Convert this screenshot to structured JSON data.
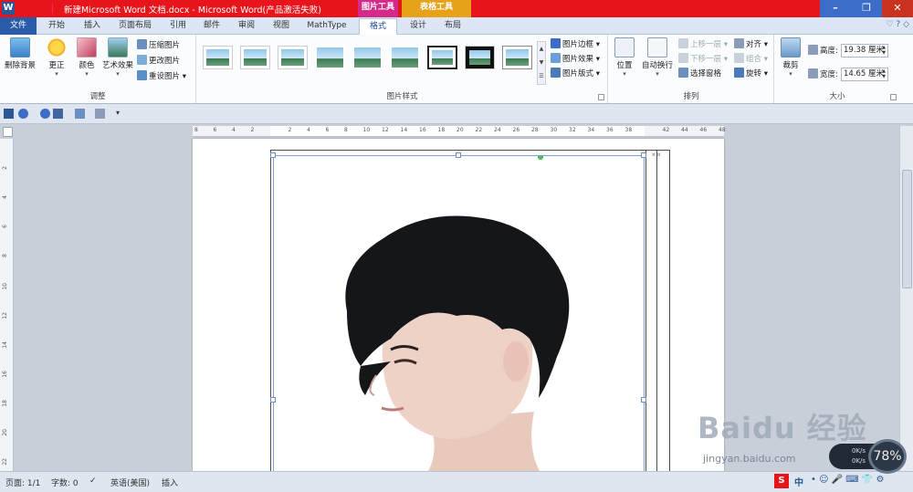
{
  "titlebar": {
    "logo": "W",
    "title": "新建Microsoft Word 文档.docx - Microsoft Word(产品激活失败)",
    "context_picture": "图片工具",
    "context_table": "表格工具",
    "min": "–",
    "max": "❐",
    "close": "✕"
  },
  "tabs": {
    "file": "文件",
    "items": [
      "开始",
      "插入",
      "页面布局",
      "引用",
      "邮件",
      "审阅",
      "视图",
      "MathType",
      "格式",
      "设计",
      "布局"
    ],
    "right_icons": "♡ ? ◇"
  },
  "ribbon": {
    "adjust": {
      "label": "调整",
      "remove_bg": "删除背景",
      "correct": "更正",
      "color": "颜色",
      "art_effects": "艺术效果",
      "compress": "压缩图片",
      "change": "更改图片",
      "reset": "重设图片"
    },
    "styles": {
      "label": "图片样式",
      "border": "图片边框",
      "effects": "图片效果",
      "layout": "图片版式"
    },
    "arrange": {
      "label": "排列",
      "position": "位置",
      "wrap": "自动换行",
      "forward": "上移一层",
      "backward": "下移一层",
      "selection_pane": "选择窗格",
      "align": "对齐",
      "group": "组合",
      "rotate": "旋转"
    },
    "size": {
      "label": "大小",
      "crop": "裁剪",
      "height_label": "高度:",
      "height_value": "19.38 厘米",
      "width_label": "宽度:",
      "width_value": "14.65 厘米"
    }
  },
  "ruler": {
    "h_ticks": [
      "8",
      "6",
      "4",
      "2",
      "",
      "2",
      "4",
      "6",
      "8",
      "10",
      "12",
      "14",
      "16",
      "18",
      "20",
      "22",
      "24",
      "26",
      "28",
      "30",
      "32",
      "34",
      "36",
      "38",
      "",
      "42",
      "44",
      "46",
      "48"
    ],
    "v_ticks": [
      "2",
      "4",
      "6",
      "8",
      "10",
      "12",
      "14",
      "16",
      "18",
      "20",
      "22"
    ]
  },
  "status": {
    "page": "页面: 1/1",
    "words": "字数: 0",
    "language": "英语(美国)",
    "insert": "插入"
  },
  "watermark": {
    "brand": "Bai⁠du 经验",
    "url": "jingyan.baidu.com"
  },
  "overlay": {
    "net_speed": "0K/s",
    "net_speed2": "0K/s",
    "gauge": "78%"
  },
  "ime": {
    "s": "S",
    "lang": "中",
    "items": "• ☺ 🎤 ⌨ 👕 ⚙"
  },
  "colors": {
    "titlebar": "#e8141c",
    "picture_tools": "#d42a8a",
    "table_tools": "#e8a21a",
    "file_tab": "#2a5ba8"
  }
}
